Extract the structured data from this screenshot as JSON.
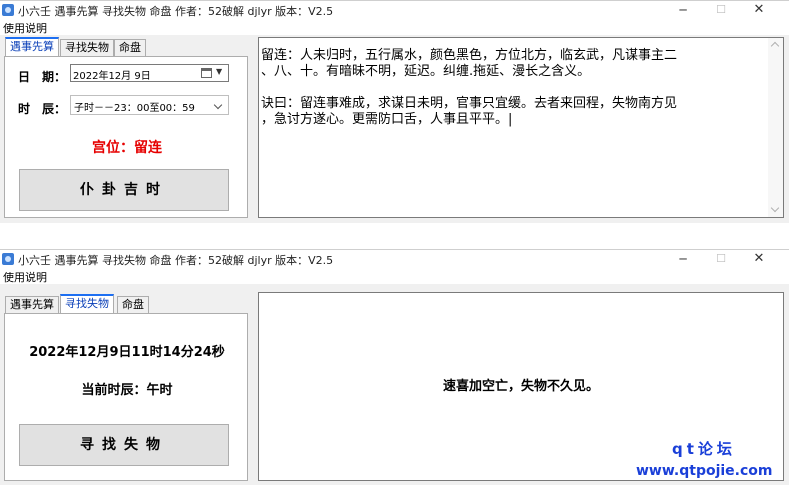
{
  "app": {
    "title": "小六壬 遇事先算 寻找失物 命盘 作者：52破解 djlyr 版本：V2.5",
    "menu_help": "使用说明",
    "controls": {
      "minimize": "─",
      "maximize": "☐",
      "close": "✕"
    }
  },
  "tabs": [
    "遇事先算",
    "寻找失物",
    "命盘"
  ],
  "window1": {
    "date_label": "日　期：",
    "date_value": "2022年12月 9日",
    "hour_label": "时　辰：",
    "hour_value": "子时－－23：00至00：59",
    "palace": "宫位：留连",
    "button": "仆卦吉时",
    "result_line1": "留连：人未归时，五行属水，颜色黑色，方位北方，临玄武，凡谋事主二",
    "result_line2": "、八、十。有暗昧不明，延迟。纠缠.拖延、漫长之含义。",
    "result_line3": "诀曰：留连事难成，求谋日未明，官事只宜缓。去者来回程，失物南方见",
    "result_line4": "，急讨方遂心。更需防口舌，人事且平平。|"
  },
  "window2": {
    "datetime": "2022年12月9日11时14分24秒",
    "current_hour": "当前时辰：午时",
    "button": "寻找失物",
    "result": "速喜加空亡，失物不久见。"
  },
  "watermark": {
    "line1": "qt论坛",
    "line2": "www.qtpojie.com"
  },
  "colors": {
    "accent_tab": "#1d6ff2",
    "palace_red": "#e60000",
    "watermark_blue": "#1a3fd8"
  }
}
